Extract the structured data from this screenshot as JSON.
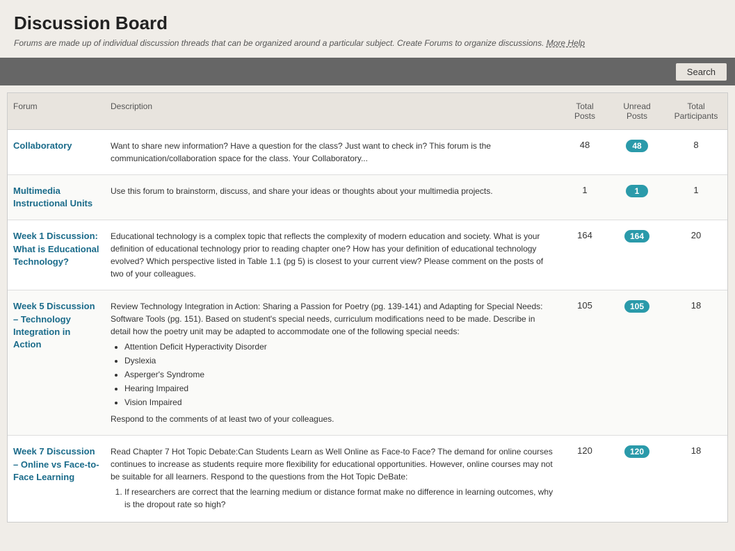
{
  "header": {
    "title": "Discussion Board",
    "subtitle": "Forums are made up of individual discussion threads that can be organized around a particular subject. Create Forums to organize discussions.",
    "more_help_link": "More Help"
  },
  "toolbar": {
    "search_label": "Search"
  },
  "table": {
    "columns": {
      "forum": "Forum",
      "description": "Description",
      "total_posts": "Total Posts",
      "unread_posts": "Unread Posts",
      "total_participants": "Total Participants"
    },
    "rows": [
      {
        "id": "collaboratory",
        "name": "Collaboratory",
        "description": "Want to share new information? Have a question for the class? Just want to check in? This forum is the communication/collaboration space for the class. Your Collaboratory...",
        "total_posts": 48,
        "unread_posts": 48,
        "total_participants": 8,
        "list_items": [],
        "extra_text": ""
      },
      {
        "id": "multimedia",
        "name": "Multimedia Instructional Units",
        "description": "Use this forum to brainstorm, discuss, and share your ideas or thoughts about your multimedia projects.",
        "total_posts": 1,
        "unread_posts": 1,
        "total_participants": 1,
        "list_items": [],
        "extra_text": ""
      },
      {
        "id": "week1",
        "name": "Week 1 Discussion: What is Educational Technology?",
        "description": "Educational technology is a complex topic that reflects the complexity of modern education and society. What is your definition of educational technology prior to reading chapter one?  How has your definition of educational technology evolved?  Which perspective listed in Table 1.1 (pg 5) is closest to your current view?  Please comment on the posts of two of your colleagues.",
        "total_posts": 164,
        "unread_posts": 164,
        "total_participants": 20,
        "list_items": [],
        "extra_text": ""
      },
      {
        "id": "week5",
        "name": "Week 5 Discussion – Technology Integration in Action",
        "description": "Review Technology Integration in Action: Sharing a Passion for Poetry (pg. 139-141) and Adapting for Special Needs: Software Tools (pg. 151). Based on student's special needs, curriculum modifications need to be made. Describe in detail how the poetry unit may be adapted to accommodate one of the following special needs:",
        "total_posts": 105,
        "unread_posts": 105,
        "total_participants": 18,
        "list_items": [
          "Attention Deficit Hyperactivity Disorder",
          "Dyslexia",
          "Asperger's Syndrome",
          "Hearing Impaired",
          "Vision Impaired"
        ],
        "extra_text": "Respond to the comments of at least two of your colleagues."
      },
      {
        "id": "week7",
        "name": "Week 7 Discussion – Online vs Face-to-Face Learning",
        "description": "Read Chapter 7 Hot Topic Debate:Can Students Learn as Well Online as Face-to Face? The demand for online courses continues to increase as students require more flexibility for educational opportunities. However, online courses may not be suitable for all learners.  Respond to the questions from the Hot Topic DeBate:",
        "total_posts": 120,
        "unread_posts": 120,
        "total_participants": 18,
        "list_items": [],
        "extra_text": "",
        "ordered_items": [
          "If researchers are correct that the learning medium or distance format make no difference in learning outcomes, why is the dropout rate so high?"
        ]
      }
    ]
  }
}
